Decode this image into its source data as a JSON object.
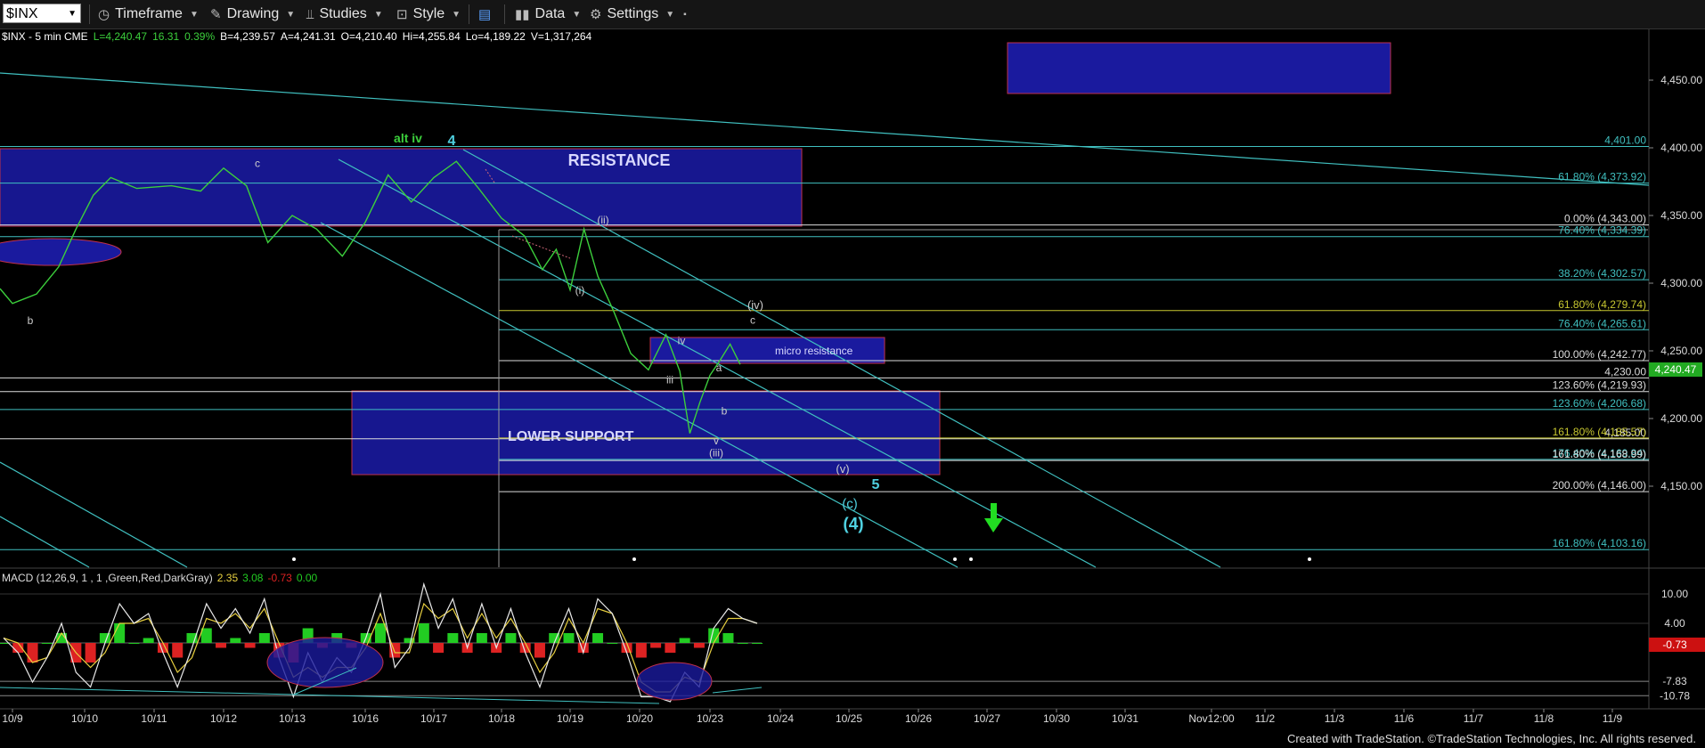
{
  "toolbar": {
    "symbol": "$INX",
    "items": [
      {
        "label": "Timeframe",
        "icon": "clock-icon"
      },
      {
        "label": "Drawing",
        "icon": "pencil-icon"
      },
      {
        "label": "Studies",
        "icon": "studies-icon"
      },
      {
        "label": "Style",
        "icon": "style-icon"
      },
      {
        "label": "Data",
        "icon": "bar-chart-icon"
      },
      {
        "label": "Settings",
        "icon": "gear-icon"
      }
    ]
  },
  "info": {
    "symbol": "$INX - 5 min CME",
    "last": "L=4,240.47",
    "change": "16.31",
    "change_pct": "0.39%",
    "bid": "B=4,239.57",
    "ask": "A=4,241.31",
    "open": "O=4,210.40",
    "high": "Hi=4,255.84",
    "low": "Lo=4,189.22",
    "volume": "V=1,317,264"
  },
  "colors": {
    "background": "#000000",
    "price_line": "#3ccf3c",
    "zone_fill": "#1a1a9e",
    "zone_border": "#c0304a",
    "fib_line": "#40c0c0",
    "label_cyan": "#4fd0e0",
    "macd_line": "#e8e8e8",
    "signal_line": "#e8d040",
    "hist_up": "#22cc22",
    "hist_down": "#dd2222",
    "arrow_green": "#22dd22"
  },
  "chart_data": {
    "type": "line",
    "title": "$INX - 5 min CME",
    "ylim": [
      4085,
      4485
    ],
    "y_ticks": [
      "4,450.00",
      "4,400.00",
      "4,350.00",
      "4,300.00",
      "4,250.00",
      "4,200.00",
      "4,150.00"
    ],
    "x_tick_labels": [
      "10/9",
      "10/10",
      "10/11",
      "10/12",
      "10/13",
      "10/16",
      "10/17",
      "10/18",
      "10/19",
      "10/20",
      "10/23",
      "10/24",
      "10/25",
      "10/26",
      "10/27",
      "10/30",
      "10/31",
      "Nov12:00",
      "11/2",
      "11/3",
      "11/6",
      "11/7",
      "11/8",
      "11/9"
    ],
    "price_series": {
      "name": "$INX",
      "points": [
        [
          "10/9",
          4296
        ],
        [
          "10/9",
          4285
        ],
        [
          "10/9",
          4292
        ],
        [
          "10/10",
          4312
        ],
        [
          "10/10",
          4340
        ],
        [
          "10/10",
          4365
        ],
        [
          "10/10",
          4378
        ],
        [
          "10/11",
          4370
        ],
        [
          "10/11",
          4372
        ],
        [
          "10/12",
          4368
        ],
        [
          "10/12",
          4385
        ],
        [
          "10/12",
          4372
        ],
        [
          "10/13",
          4330
        ],
        [
          "10/13",
          4350
        ],
        [
          "10/13",
          4340
        ],
        [
          "10/16",
          4320
        ],
        [
          "10/16",
          4345
        ],
        [
          "10/16",
          4380
        ],
        [
          "10/17",
          4360
        ],
        [
          "10/17",
          4378
        ],
        [
          "10/17",
          4390
        ],
        [
          "10/18",
          4370
        ],
        [
          "10/18",
          4348
        ],
        [
          "10/18",
          4335
        ],
        [
          "10/19",
          4310
        ],
        [
          "10/19",
          4325
        ],
        [
          "10/19",
          4295
        ],
        [
          "10/19",
          4340
        ],
        [
          "10/19",
          4305
        ],
        [
          "10/20",
          4280
        ],
        [
          "10/20",
          4248
        ],
        [
          "10/20",
          4236
        ],
        [
          "10/20",
          4262
        ],
        [
          "10/23",
          4235
        ],
        [
          "10/23",
          4189
        ],
        [
          "10/23",
          4212
        ],
        [
          "10/23",
          4232
        ],
        [
          "10/23",
          4243
        ],
        [
          "10/23",
          4255
        ],
        [
          "10/23",
          4240
        ]
      ]
    },
    "horizontal_levels": [
      {
        "label": "4,401.00",
        "value": 4401.0
      },
      {
        "label": "61.80% (4,373.92)",
        "value": 4373.92
      },
      {
        "label": "0.00% (4,343.00)",
        "value": 4343.0
      },
      {
        "label": "76.40% (4,334.39)",
        "value": 4334.39
      },
      {
        "label": "38.20% (4,302.57)",
        "value": 4302.57
      },
      {
        "label": "61.80% (4,279.74)",
        "value": 4279.74
      },
      {
        "label": "76.40% (4,265.61)",
        "value": 4265.61
      },
      {
        "label": "100.00% (4,242.77)",
        "value": 4242.77
      },
      {
        "label": "4,230.00",
        "value": 4230.0
      },
      {
        "label": "123.60% (4,219.93)",
        "value": 4219.93
      },
      {
        "label": "123.60% (4,206.68)",
        "value": 4206.68
      },
      {
        "label": "4,185.00",
        "value": 4185.0
      },
      {
        "label": "161.80% (4,185.57)",
        "value": 4185.57
      },
      {
        "label": "176.40% (4,169.84)",
        "value": 4169.84
      },
      {
        "label": "161.80% (4,168.99)",
        "value": 4168.99
      },
      {
        "label": "200.00% (4,146.00)",
        "value": 4146.0
      },
      {
        "label": "161.80% (4,103.16)",
        "value": 4103.16
      }
    ],
    "zones": [
      {
        "label": "RESISTANCE",
        "from": "10/9",
        "to": "10/19",
        "y_low": 4344,
        "y_high": 4400
      },
      {
        "label": "LOWER SUPPORT",
        "from": "10/16",
        "to": "10/25",
        "y_low": 4166,
        "y_high": 4227
      },
      {
        "label": "micro resistance",
        "from": "10/20",
        "to": "10/24",
        "y_low": 4238,
        "y_high": 4257
      },
      {
        "label": "",
        "from": "10/27",
        "to": "11/2",
        "y_low": 4443,
        "y_high": 4480
      }
    ],
    "wave_labels": [
      {
        "text": "alt iv",
        "value": 4404
      },
      {
        "text": "4",
        "value": 4404
      },
      {
        "text": "c",
        "value": 4386
      },
      {
        "text": "b",
        "value": 4278
      },
      {
        "text": "(ii)",
        "value": 4344
      },
      {
        "text": "(i)",
        "value": 4292
      },
      {
        "text": "iv",
        "value": 4255
      },
      {
        "text": "iii",
        "value": 4226
      },
      {
        "text": "a",
        "value": 4235
      },
      {
        "text": "b",
        "value": 4203
      },
      {
        "text": "v",
        "value": 4181
      },
      {
        "text": "(iii)",
        "value": 4172
      },
      {
        "text": "(iv)",
        "value": 4281
      },
      {
        "text": "c",
        "value": 4270
      },
      {
        "text": "(v)",
        "value": 4160
      },
      {
        "text": "5",
        "value": 4148
      },
      {
        "text": "(c)",
        "value": 4134
      },
      {
        "text": "(4)",
        "value": 4118
      }
    ],
    "current_price_tag": "4,240.47",
    "macd": {
      "legend": "MACD (12,26,9, 1 , 1 ,Green,Red,DarkGray)",
      "values": [
        "2.35",
        "3.08",
        "-0.73",
        "0.00"
      ],
      "y_ticks": [
        "10.00",
        "4.00",
        "-7.83",
        "-10.78"
      ],
      "current_tag": "-0.73",
      "ylim": [
        -13,
        13
      ],
      "macd_line": [
        1,
        -2,
        -8,
        -3,
        4,
        -6,
        -9,
        0,
        8,
        4,
        6,
        -2,
        -9,
        -1,
        8,
        3,
        7,
        2,
        9,
        -3,
        -11,
        -2,
        -8,
        -3,
        -6,
        1,
        10,
        -5,
        -1,
        12,
        3,
        9,
        -1,
        8,
        -1,
        7,
        -2,
        -9,
        0,
        7,
        -2,
        9,
        6,
        -2,
        -11,
        -11,
        -12,
        -6,
        -9,
        3,
        7,
        5,
        4
      ],
      "signal_line": [
        1,
        0,
        -4,
        -3,
        2,
        -2,
        -5,
        -2,
        4,
        4,
        5,
        0,
        -6,
        -3,
        5,
        4,
        6,
        3,
        7,
        0,
        -7,
        -5,
        -7,
        -5,
        -5,
        -1,
        6,
        -2,
        -2,
        8,
        5,
        7,
        1,
        6,
        1,
        5,
        0,
        -6,
        -2,
        5,
        0,
        7,
        6,
        0,
        -8,
        -10,
        -10,
        -7,
        -8,
        0,
        5,
        5,
        4
      ]
    }
  },
  "footer": "Created with TradeStation. ©TradeStation Technologies, Inc. All rights reserved."
}
